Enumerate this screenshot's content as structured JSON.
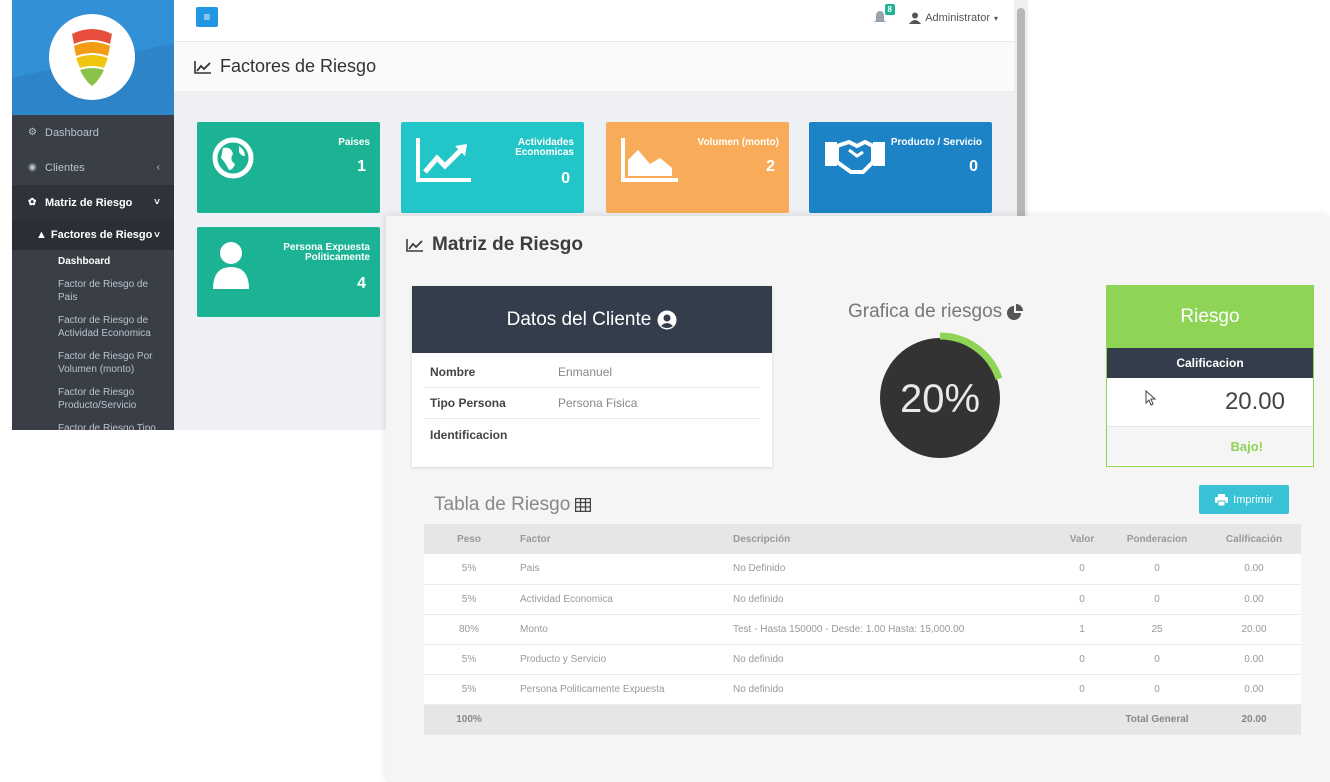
{
  "sidebar": {
    "items": [
      {
        "label": "Dashboard",
        "icon": "dashboard-icon"
      },
      {
        "label": "Clientes",
        "icon": "user-circle-icon"
      },
      {
        "label": "Matriz de Riesgo",
        "icon": "gear-icon"
      }
    ],
    "sub": {
      "label": "Factores de Riesgo",
      "icon": "warning-icon"
    },
    "leaves": [
      "Dashboard",
      "Factor de Riesgo de Pais",
      "Factor de Riesgo de Actividad Economica",
      "Factor de Riesgo Por Volumen (monto)",
      "Factor de Riesgo Producto/Servicio",
      "Factor de Riesgo Tipo de Persona Expuesta"
    ]
  },
  "topbar": {
    "notif_count": "8",
    "user": "Administrator"
  },
  "back_page": {
    "title": "Factores de Riesgo"
  },
  "tiles": [
    {
      "label": "Paises",
      "value": "1",
      "color": "#1cb394",
      "icon": "globe-icon"
    },
    {
      "label": "Actividades Economicas",
      "value": "0",
      "color": "#23c6c8",
      "icon": "trend-up-icon"
    },
    {
      "label": "Volumen (monto)",
      "value": "2",
      "color": "#f8ac59",
      "icon": "area-chart-icon"
    },
    {
      "label": "Producto / Servicio",
      "value": "0",
      "color": "#1c84c6",
      "icon": "handshake-icon"
    },
    {
      "label": "Persona Expuesta Politicamente",
      "value": "4",
      "color": "#1cb394",
      "icon": "user-icon"
    }
  ],
  "front_page": {
    "title": "Matriz de Riesgo",
    "client": {
      "title": "Datos del Cliente",
      "rows": [
        {
          "key": "Nombre",
          "value": "Enmanuel"
        },
        {
          "key": "Tipo Persona",
          "value": "Persona Fisica"
        },
        {
          "key": "Identificacion",
          "value": ""
        }
      ]
    },
    "chart_title": "Grafica de riesgos",
    "risk_percent": 20,
    "risk_percent_label": "20%",
    "risk_card": {
      "title": "Riesgo",
      "calif_label": "Calificacion",
      "calif_value": "20.00",
      "level": "Bajo!"
    },
    "table_title": "Tabla de Riesgo",
    "print_label": "Imprimir",
    "table": {
      "headers": [
        "Peso",
        "Factor",
        "Descripción",
        "Valor",
        "Ponderacion",
        "Calificación"
      ],
      "rows": [
        [
          "5%",
          "Pais",
          "No Definido",
          "0",
          "0",
          "0.00"
        ],
        [
          "5%",
          "Actividad Economica",
          "No definido",
          "0",
          "0",
          "0.00"
        ],
        [
          "80%",
          "Monto",
          "Test - Hasta 150000 - Desde: 1.00 Hasta: 15,000.00",
          "1",
          "25",
          "20.00"
        ],
        [
          "5%",
          "Producto y Servicio",
          "No definido",
          "0",
          "0",
          "0.00"
        ],
        [
          "5%",
          "Persona Politicamente Expuesta",
          "No definido",
          "0",
          "0",
          "0.00"
        ]
      ],
      "total": {
        "peso": "100%",
        "label": "Total General",
        "value": "20.00"
      }
    }
  }
}
